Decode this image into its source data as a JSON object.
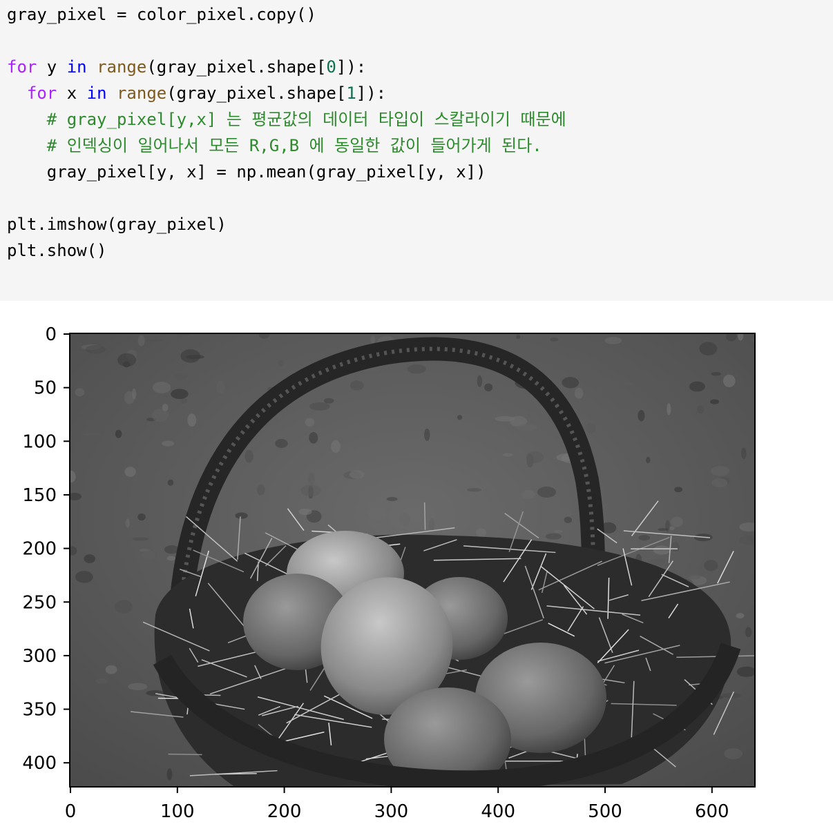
{
  "code_cell": {
    "lines": [
      {
        "segments": [
          {
            "text": "gray_pixel = color_pixel.copy()",
            "cls": ""
          }
        ]
      },
      {
        "segments": []
      },
      {
        "segments": [
          {
            "text": "for",
            "cls": "kw"
          },
          {
            "text": " y ",
            "cls": ""
          },
          {
            "text": "in",
            "cls": "in-kw"
          },
          {
            "text": " ",
            "cls": ""
          },
          {
            "text": "range",
            "cls": "bi"
          },
          {
            "text": "(gray_pixel.shape[",
            "cls": ""
          },
          {
            "text": "0",
            "cls": "num"
          },
          {
            "text": "]):",
            "cls": ""
          }
        ]
      },
      {
        "segments": [
          {
            "text": "  ",
            "cls": ""
          },
          {
            "text": "for",
            "cls": "kw"
          },
          {
            "text": " x ",
            "cls": ""
          },
          {
            "text": "in",
            "cls": "in-kw"
          },
          {
            "text": " ",
            "cls": ""
          },
          {
            "text": "range",
            "cls": "bi"
          },
          {
            "text": "(gray_pixel.shape[",
            "cls": ""
          },
          {
            "text": "1",
            "cls": "num"
          },
          {
            "text": "]):",
            "cls": ""
          }
        ]
      },
      {
        "segments": [
          {
            "text": "    ",
            "cls": ""
          },
          {
            "text": "# gray_pixel[y,x] 는 평균값의 데이터 타입이 스칼라이기 때문에",
            "cls": "cm"
          }
        ]
      },
      {
        "segments": [
          {
            "text": "    ",
            "cls": ""
          },
          {
            "text": "# 인덱싱이 일어나서 모든 R,G,B 에 동일한 값이 들어가게 된다.",
            "cls": "cm"
          }
        ]
      },
      {
        "segments": [
          {
            "text": "    gray_pixel[y, x] = np.mean(gray_pixel[y, x])",
            "cls": ""
          }
        ]
      },
      {
        "segments": []
      },
      {
        "segments": [
          {
            "text": "plt.imshow(gray_pixel)",
            "cls": ""
          }
        ]
      },
      {
        "segments": [
          {
            "text": "plt.show()",
            "cls": ""
          }
        ]
      }
    ]
  },
  "plot": {
    "y_ticks": [
      "0",
      "50",
      "100",
      "150",
      "200",
      "250",
      "300",
      "350",
      "400"
    ],
    "x_ticks": [
      "0",
      "100",
      "200",
      "300",
      "400",
      "500",
      "600"
    ],
    "image_description_icon": "grayscale-basket-image",
    "colors": {
      "background": "#5e5e5e",
      "grass_dark": "#3a3a3a",
      "basket": "#2a2a2a",
      "egg_light": "#a8a8a8",
      "straw": "#c8c8c8"
    }
  }
}
